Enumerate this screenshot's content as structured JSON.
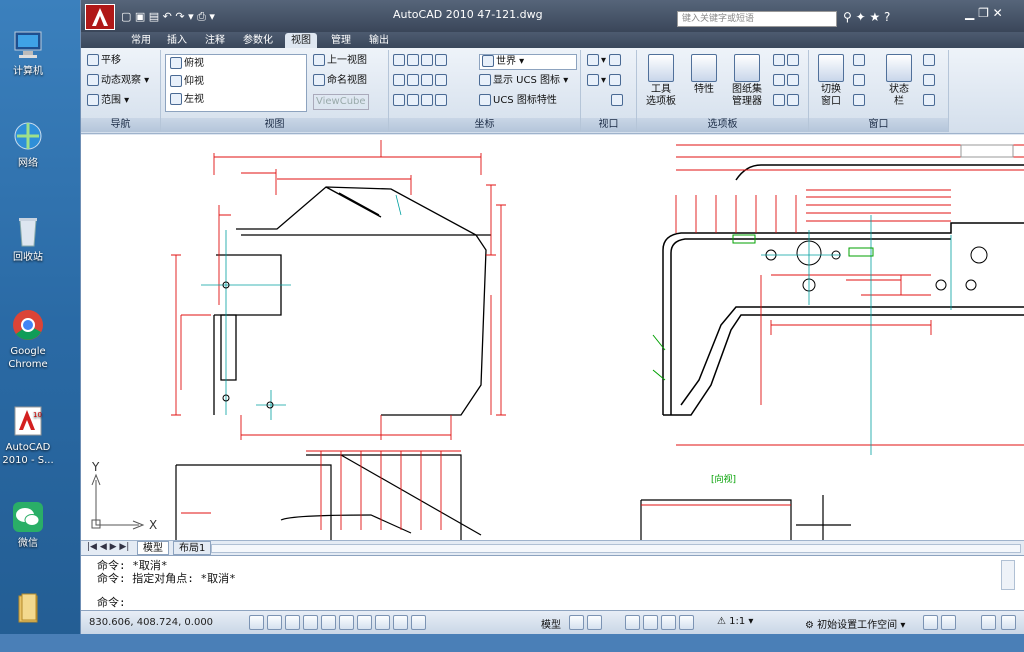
{
  "desktop": {
    "icons": [
      {
        "label": "计算机",
        "name": "computer"
      },
      {
        "label": "网络",
        "name": "network"
      },
      {
        "label": "回收站",
        "name": "recycle-bin"
      },
      {
        "label": "Google Chrome",
        "name": "chrome"
      },
      {
        "label": "AutoCAD 2010 - S...",
        "name": "autocad"
      },
      {
        "label": "微信",
        "name": "wechat"
      },
      {
        "label": "",
        "name": "folder"
      }
    ]
  },
  "app": {
    "title": "AutoCAD 2010    47-121.dwg",
    "search_placeholder": "键入关键字或短语",
    "menu_tabs": [
      "常用",
      "插入",
      "注释",
      "参数化",
      "视图",
      "管理",
      "输出"
    ],
    "active_tab": "视图",
    "ribbon": {
      "nav": {
        "items": [
          "平移",
          "动态观察",
          "范围"
        ],
        "title": "导航"
      },
      "view": {
        "list": [
          "俯视",
          "仰视",
          "左视"
        ],
        "prev": "上一视图",
        "named": "命名视图",
        "viewcube": "ViewCube",
        "title": "视图"
      },
      "coords": {
        "world": "世界",
        "show_ucs": "显示 UCS 图标",
        "ucs_props": "UCS 图标特性",
        "title": "坐标"
      },
      "viewport": {
        "title": "视口"
      },
      "palettes": {
        "tool": "工具\n选项板",
        "props": "特性",
        "sheetset": "图纸集\n管理器",
        "title": "选项板"
      },
      "window": {
        "switch": "切换\n窗口",
        "status": "状态\n栏",
        "title": "窗口"
      }
    },
    "layout_tabs": [
      "模型",
      "布局1"
    ],
    "command_lines": [
      "命令: *取消*",
      "命令: 指定对角点: *取消*",
      "",
      "命令:"
    ],
    "coords_readout": "830.606, 408.724, 0.000",
    "status": {
      "model": "模型",
      "scale": "1:1",
      "workspace": "初始设置工作空间"
    },
    "drawing_labels": {
      "section": "[向视]",
      "axis_x": "X",
      "axis_y": "Y"
    }
  },
  "colors": {
    "ribbon_bg": "#dfe7f1",
    "title_bg": "#3a4659",
    "dim_red": "#e01010",
    "dim_green": "#00a000",
    "cad_line": "#000000"
  }
}
